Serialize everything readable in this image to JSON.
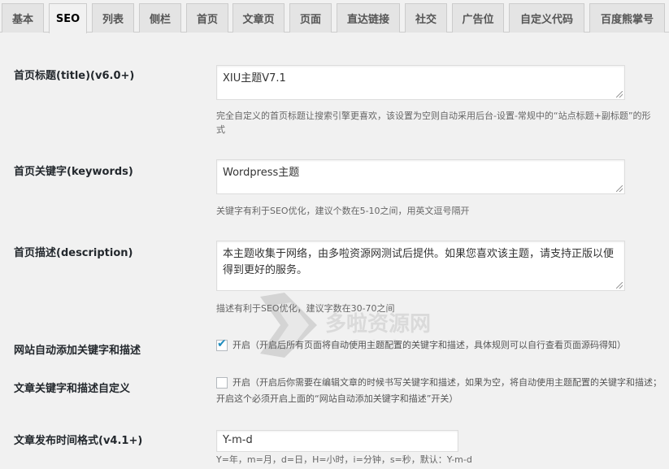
{
  "tabs": [
    {
      "label": "基本"
    },
    {
      "label": "SEO",
      "active": true
    },
    {
      "label": "列表"
    },
    {
      "label": "侧栏"
    },
    {
      "label": "首页"
    },
    {
      "label": "文章页"
    },
    {
      "label": "页面"
    },
    {
      "label": "直达链接"
    },
    {
      "label": "社交"
    },
    {
      "label": "广告位"
    },
    {
      "label": "自定义代码"
    },
    {
      "label": "百度熊掌号"
    }
  ],
  "settings": {
    "home_title": {
      "label": "首页标题(title)(v6.0+)",
      "value": "XIU主题V7.1",
      "desc": "完全自定义的首页标题让搜索引擎更喜欢，该设置为空则自动采用后台-设置-常规中的“站点标题+副标题”的形式"
    },
    "home_keywords": {
      "label": "首页关键字(keywords)",
      "value": "Wordpress主题",
      "desc": "关键字有利于SEO优化，建议个数在5-10之间，用英文逗号隔开"
    },
    "home_description": {
      "label": "首页描述(description)",
      "value": "本主题收集于网络，由多啦资源网测试后提供。如果您喜欢该主题，请支持正版以便得到更好的服务。",
      "desc": "描述有利于SEO优化，建议字数在30-70之间"
    },
    "auto_keywords": {
      "label": "网站自动添加关键字和描述",
      "checked": true,
      "text": "开启（开启后所有页面将自动使用主题配置的关键字和描述，具体规则可以自行查看页面源码得知）"
    },
    "post_custom_keywords": {
      "label": "文章关键字和描述自定义",
      "checked": false,
      "text": "开启（开启后你需要在编辑文章的时候书写关键字和描述，如果为空，将自动使用主题配置的关键字和描述；开启这个必须开启上面的“网站自动添加关键字和描述”开关）"
    },
    "date_format": {
      "label": "文章发布时间格式(v4.1+)",
      "value": "Y-m-d",
      "desc": "Y=年，m=月，d=日，H=小时，i=分钟，s=秒，默认：Y-m-d"
    }
  },
  "watermark": {
    "title": "多啦资源网",
    "url": "www.Duolasoft.com"
  },
  "colors": {
    "accent": "#1e8cbe",
    "background": "#f1f1f1"
  }
}
